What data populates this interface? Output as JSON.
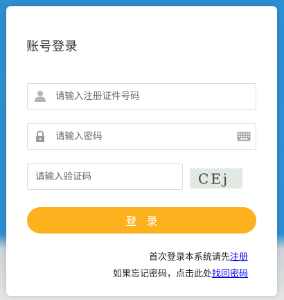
{
  "login": {
    "title": "账号登录",
    "username": {
      "placeholder": "请输入注册证件号码",
      "icon": "user-icon"
    },
    "password": {
      "placeholder": "请输入密码",
      "icon": "lock-icon",
      "keyboard_icon": "keyboard-icon"
    },
    "captcha": {
      "placeholder": "请输入验证码",
      "image_text": "CEj 4"
    },
    "submit_label": "登录",
    "register_prompt": "首次登录本系统请先",
    "register_link": "注册",
    "forgot_prompt": "如果忘记密码，点击此处",
    "forgot_link": "找回密码"
  },
  "colors": {
    "background": "#2f8ecf",
    "button": "#fcb11f",
    "link": "#0000ee"
  }
}
